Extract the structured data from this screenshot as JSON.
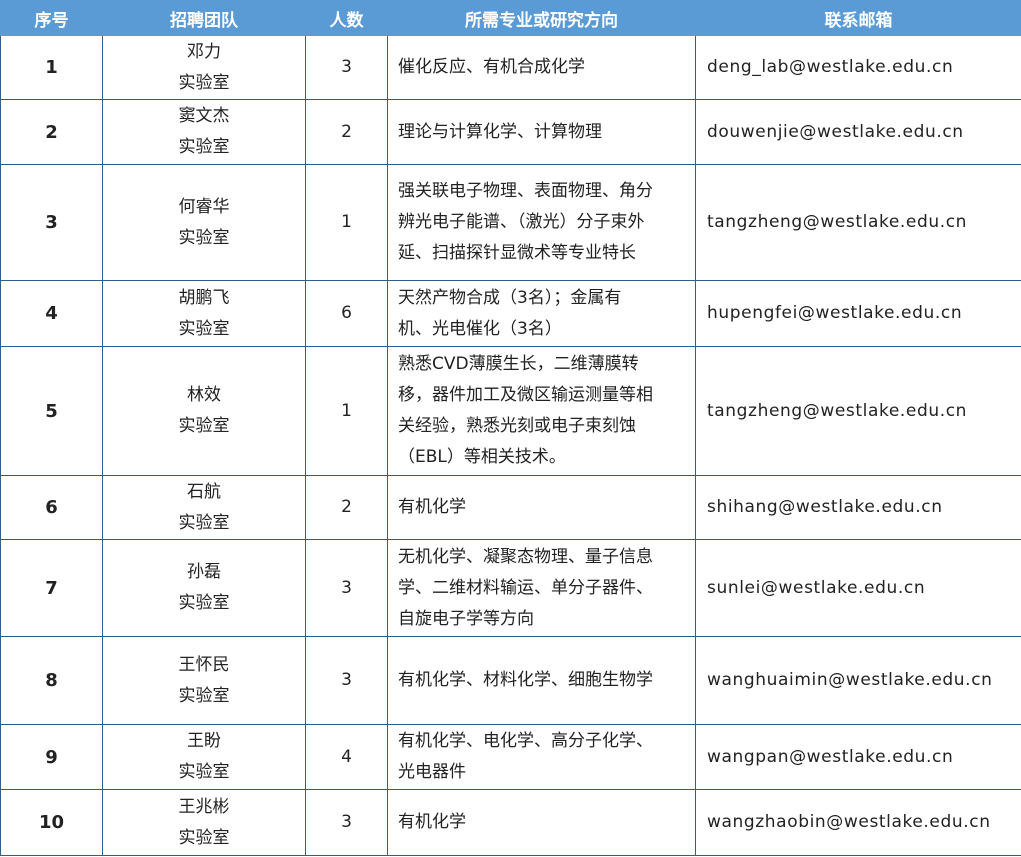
{
  "header": {
    "col_index": "序号",
    "col_team": "招聘团队",
    "col_count": "人数",
    "col_field": "所需专业或研究方向",
    "col_email": "联系邮箱"
  },
  "rows": [
    {
      "index": "1",
      "team": [
        "邓力",
        "实验室"
      ],
      "count": "3",
      "field": [
        "催化反应、有机合成化学"
      ],
      "email": "deng_lab@westlake.edu.cn"
    },
    {
      "index": "2",
      "team": [
        "窦文杰",
        "实验室"
      ],
      "count": "2",
      "field": [
        "理论与计算化学、计算物理"
      ],
      "email": "douwenjie@westlake.edu.cn"
    },
    {
      "index": "3",
      "team": [
        "何睿华",
        "实验室"
      ],
      "count": "1",
      "field": [
        "强关联电子物理、表面物理、角分",
        "辨光电子能谱、（激光）分子束外",
        "延、扫描探针显微术等专业特长"
      ],
      "email": "tangzheng@westlake.edu.cn"
    },
    {
      "index": "4",
      "team": [
        "胡鹏飞",
        "实验室"
      ],
      "count": "6",
      "field": [
        "天然产物合成（3名）；金属有",
        "机、光电催化（3名）"
      ],
      "email": "hupengfei@westlake.edu.cn"
    },
    {
      "index": "5",
      "team": [
        "林效",
        "实验室"
      ],
      "count": "1",
      "field": [
        "熟悉CVD薄膜生长，二维薄膜转",
        "移，器件加工及微区输运测量等相",
        "关经验，熟悉光刻或电子束刻蚀",
        "（EBL）等相关技术。"
      ],
      "email": "tangzheng@westlake.edu.cn"
    },
    {
      "index": "6",
      "team": [
        "石航",
        "实验室"
      ],
      "count": "2",
      "field": [
        "有机化学"
      ],
      "email": "shihang@westlake.edu.cn"
    },
    {
      "index": "7",
      "team": [
        "孙磊",
        "实验室"
      ],
      "count": "3",
      "field": [
        "无机化学、凝聚态物理、量子信息",
        "学、二维材料输运、单分子器件、",
        "自旋电子学等方向"
      ],
      "email": "sunlei@westlake.edu.cn"
    },
    {
      "index": "8",
      "team": [
        "王怀民",
        "实验室"
      ],
      "count": "3",
      "field": [
        "有机化学、材料化学、细胞生物学"
      ],
      "email": "wanghuaimin@westlake.edu.cn"
    },
    {
      "index": "9",
      "team": [
        "王盼",
        "实验室"
      ],
      "count": "4",
      "field": [
        "有机化学、电化学、高分子化学、",
        "光电器件"
      ],
      "email": "wangpan@westlake.edu.cn"
    },
    {
      "index": "10",
      "team": [
        "王兆彬",
        "实验室"
      ],
      "count": "3",
      "field": [
        "有机化学"
      ],
      "email": "wangzhaobin@westlake.edu.cn"
    }
  ]
}
